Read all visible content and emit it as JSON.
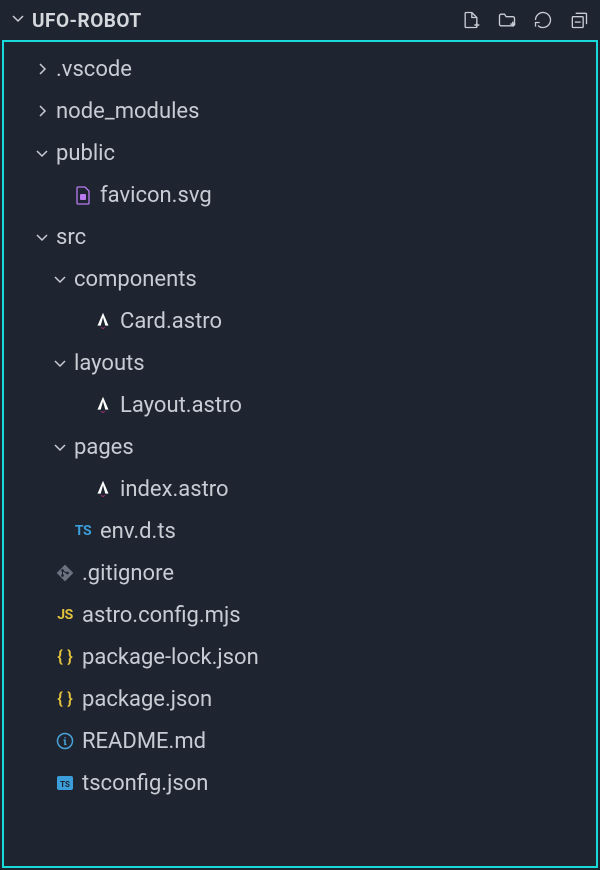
{
  "header": {
    "title": "UFO-ROBOT"
  },
  "tree": {
    "items": [
      {
        "label": ".vscode",
        "type": "folder",
        "expanded": false,
        "depth": 1,
        "icon": "chevron-right"
      },
      {
        "label": "node_modules",
        "type": "folder",
        "expanded": false,
        "depth": 1,
        "icon": "chevron-right"
      },
      {
        "label": "public",
        "type": "folder",
        "expanded": true,
        "depth": 1,
        "icon": "chevron-down"
      },
      {
        "label": "favicon.svg",
        "type": "file",
        "depth": 2,
        "icon": "svg"
      },
      {
        "label": "src",
        "type": "folder",
        "expanded": true,
        "depth": 1,
        "icon": "chevron-down"
      },
      {
        "label": "components",
        "type": "folder",
        "expanded": true,
        "depth": 2,
        "icon": "chevron-down"
      },
      {
        "label": "Card.astro",
        "type": "file",
        "depth": 3,
        "icon": "astro"
      },
      {
        "label": "layouts",
        "type": "folder",
        "expanded": true,
        "depth": 2,
        "icon": "chevron-down"
      },
      {
        "label": "Layout.astro",
        "type": "file",
        "depth": 3,
        "icon": "astro"
      },
      {
        "label": "pages",
        "type": "folder",
        "expanded": true,
        "depth": 2,
        "icon": "chevron-down"
      },
      {
        "label": "index.astro",
        "type": "file",
        "depth": 3,
        "icon": "astro"
      },
      {
        "label": "env.d.ts",
        "type": "file",
        "depth": 2,
        "icon": "ts"
      },
      {
        "label": ".gitignore",
        "type": "file",
        "depth": 1,
        "icon": "git"
      },
      {
        "label": "astro.config.mjs",
        "type": "file",
        "depth": 1,
        "icon": "js"
      },
      {
        "label": "package-lock.json",
        "type": "file",
        "depth": 1,
        "icon": "json"
      },
      {
        "label": "package.json",
        "type": "file",
        "depth": 1,
        "icon": "json"
      },
      {
        "label": "README.md",
        "type": "file",
        "depth": 1,
        "icon": "info"
      },
      {
        "label": "tsconfig.json",
        "type": "file",
        "depth": 1,
        "icon": "tsconfig"
      }
    ]
  }
}
